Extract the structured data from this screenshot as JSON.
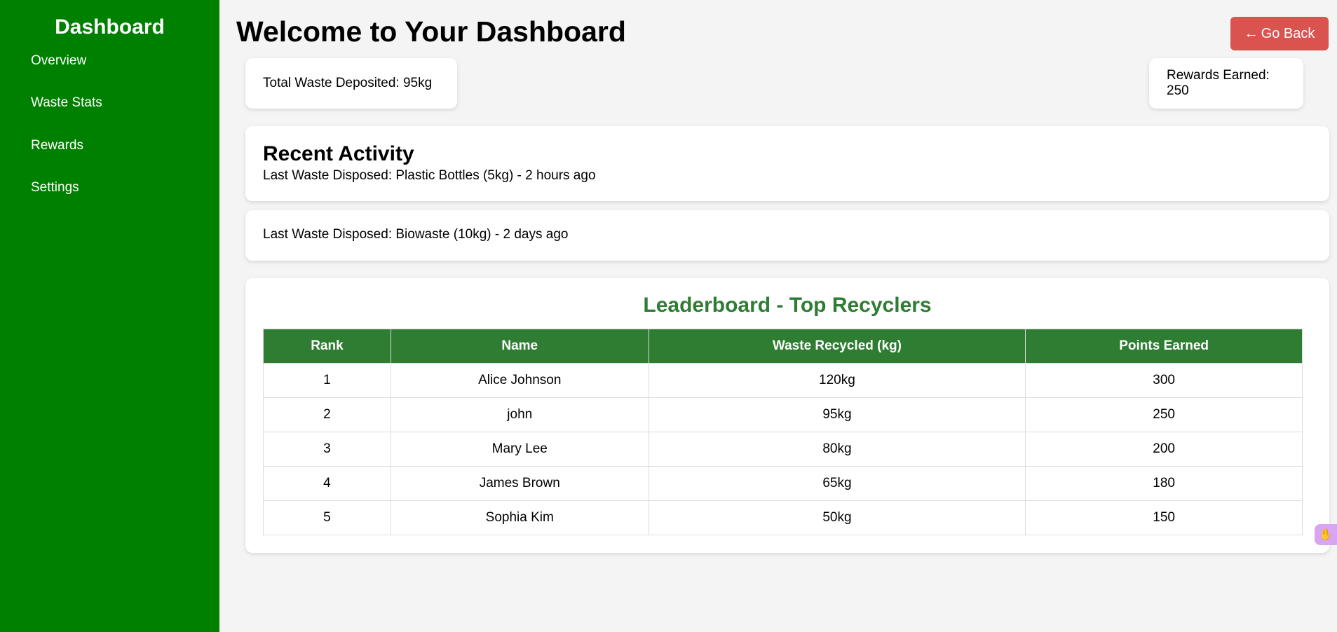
{
  "sidebar": {
    "title": "Dashboard",
    "items": [
      {
        "label": "Overview"
      },
      {
        "label": "Waste Stats"
      },
      {
        "label": "Rewards"
      },
      {
        "label": "Settings"
      }
    ]
  },
  "header": {
    "title": "Welcome to Your Dashboard",
    "back_button": {
      "icon": "arrow-left-icon",
      "arrow": "←",
      "label": "Go Back"
    }
  },
  "stats": {
    "total_waste": "Total Waste Deposited: 95kg",
    "rewards": "Rewards Earned: 250"
  },
  "activity": {
    "title": "Recent Activity",
    "entries": [
      "Last Waste Disposed: Plastic Bottles (5kg) - 2 hours ago",
      "Last Waste Disposed: Biowaste (10kg) - 2 days ago"
    ]
  },
  "leaderboard": {
    "title": "Leaderboard - Top Recyclers",
    "columns": [
      "Rank",
      "Name",
      "Waste Recycled (kg)",
      "Points Earned"
    ],
    "rows": [
      [
        "1",
        "Alice Johnson",
        "120kg",
        "300"
      ],
      [
        "2",
        "john",
        "95kg",
        "250"
      ],
      [
        "3",
        "Mary Lee",
        "80kg",
        "200"
      ],
      [
        "4",
        "James Brown",
        "65kg",
        "180"
      ],
      [
        "5",
        "Sophia Kim",
        "50kg",
        "150"
      ]
    ]
  },
  "colors": {
    "sidebar_bg": "#008000",
    "accent_green": "#2e7d32",
    "back_button": "#d9534f",
    "page_bg": "#f4f4f4"
  },
  "widget": {
    "icon": "hand-icon"
  }
}
